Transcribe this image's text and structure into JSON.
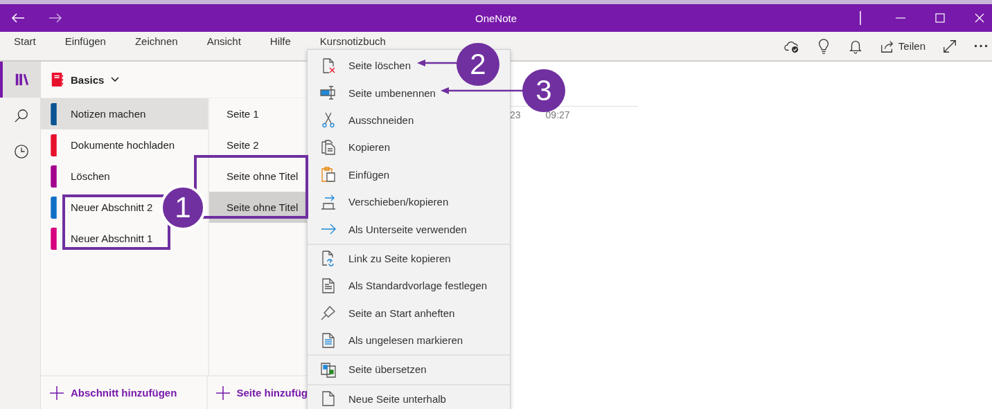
{
  "window": {
    "title": "OneNote"
  },
  "menu_bar": {
    "tabs": [
      "Start",
      "Einfügen",
      "Zeichnen",
      "Ansicht",
      "Hilfe",
      "Kursnotizbuch"
    ],
    "share_label": "Teilen"
  },
  "rail": [
    {
      "selected": true
    },
    {
      "selected": false
    },
    {
      "selected": false
    }
  ],
  "notebook": {
    "name": "Basics"
  },
  "sections": [
    {
      "name": "Notizen machen",
      "color": "#0b5394",
      "selected": true
    },
    {
      "name": "Dokumente hochladen",
      "color": "#e8112d",
      "selected": false
    },
    {
      "name": "Löschen",
      "color": "#a4008f",
      "selected": false
    },
    {
      "name": "Neuer Abschnitt 2",
      "color": "#0f6fc6",
      "selected": false
    },
    {
      "name": "Neuer Abschnitt 1",
      "color": "#d6007f",
      "selected": false
    }
  ],
  "pages": [
    {
      "title": "Seite 1",
      "selected": false
    },
    {
      "title": "Seite 2",
      "selected": false
    },
    {
      "title": "Seite ohne Titel",
      "selected": false
    },
    {
      "title": "Seite ohne Titel",
      "selected": true
    }
  ],
  "add_section": "Abschnitt hinzufügen",
  "add_page": "Seite hinzufüg",
  "page_content": {
    "date": "23",
    "time": "09:27"
  },
  "context_menu": {
    "groups": [
      [
        "Seite löschen",
        "Seite umbenennen",
        "Ausschneiden",
        "Kopieren",
        "Einfügen",
        "Verschieben/kopieren",
        "Als Unterseite verwenden"
      ],
      [
        "Link zu Seite kopieren",
        "Als Standardvorlage festlegen",
        "Seite an Start anheften",
        "Als ungelesen markieren"
      ],
      [
        "Seite übersetzen"
      ],
      [
        "Neue Seite unterhalb"
      ]
    ]
  },
  "callouts": [
    {
      "number": "1"
    },
    {
      "number": "2"
    },
    {
      "number": "3"
    }
  ]
}
